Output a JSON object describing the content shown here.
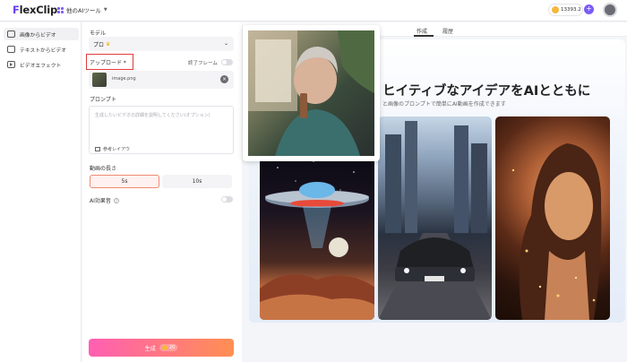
{
  "header": {
    "logo_text": "lexClip",
    "logo_first_letter": "F",
    "tools_label": "他のAIツール",
    "credits": "13393.2"
  },
  "sidebar": {
    "items": [
      {
        "label": "画像からビデオ",
        "active": true
      },
      {
        "label": "テキストからビデオ",
        "active": false
      },
      {
        "label": "ビデオエフェクト",
        "active": false
      }
    ]
  },
  "settings": {
    "model_label": "モデル",
    "model_value": "プロ",
    "upload_label": "アップロード *",
    "end_frame_label": "終了フレーム",
    "file_name": "image.png",
    "prompt_label": "プロンプト",
    "prompt_placeholder": "生成したいビデオの詳細を説明してください(オプション)",
    "prompt_example": "参考レイアウ",
    "duration_label": "動画の長さ",
    "duration_options": [
      "5s",
      "10s"
    ],
    "sound_label": "AI効果音",
    "generate_label": "生成",
    "generate_cost": "20"
  },
  "main": {
    "tabs": [
      {
        "label": "作成",
        "active": true
      },
      {
        "label": "履歴",
        "active": false
      }
    ],
    "hero_title": "ヒイティブなアイデアをAIとともに",
    "hero_subtitle": "と画像のプロンプトで簡単にAI動画を作成できます"
  },
  "colors": {
    "accent": "#7b5cf5",
    "generate_start": "#ff5fb3",
    "generate_end": "#ff8f52",
    "highlight": "#e23b3b"
  }
}
